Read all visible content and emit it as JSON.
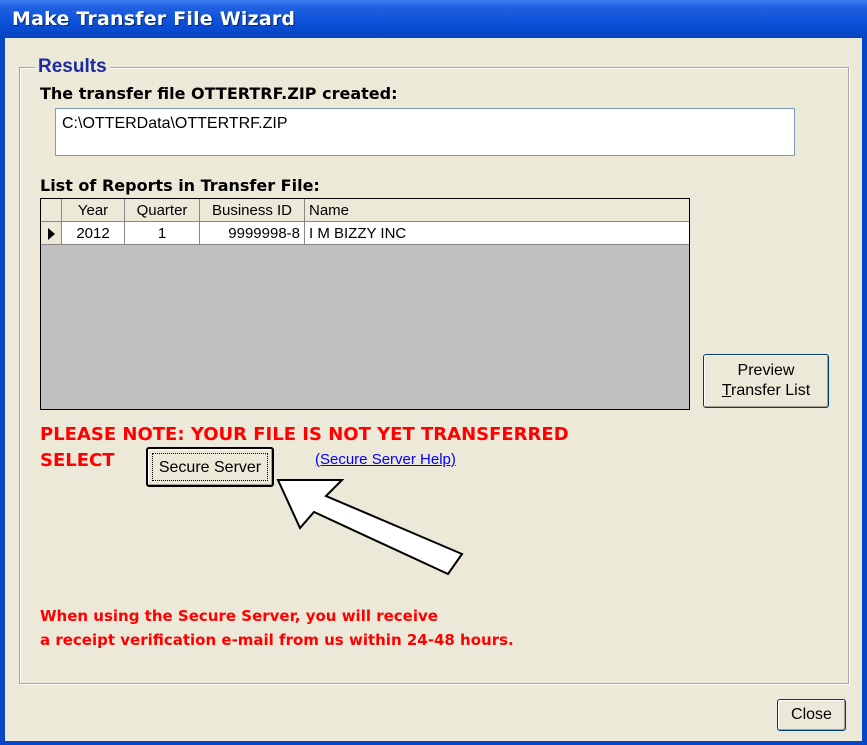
{
  "window": {
    "title": "Make Transfer File Wizard"
  },
  "results": {
    "legend": "Results",
    "created_label": "The transfer file OTTERTRF.ZIP created:",
    "file_path": "C:\\OTTERData\\OTTERTRF.ZIP",
    "list_label": "List of Reports in Transfer File:"
  },
  "grid": {
    "headers": [
      "Year",
      "Quarter",
      "Business ID",
      "Name"
    ],
    "rows": [
      {
        "year": "2012",
        "quarter": "1",
        "business_id": "9999998-8",
        "name": "I M BIZZY INC"
      }
    ]
  },
  "buttons": {
    "preview_line1": "Preview",
    "preview_line2_accel": "T",
    "preview_line2_rest": "ransfer List",
    "secure_server": "Secure Server",
    "close": "Close"
  },
  "note": {
    "warning": "PLEASE NOTE: YOUR FILE IS NOT YET TRANSFERRED",
    "select": "SELECT",
    "help_link": "(Secure Server Help)",
    "footer_line1": "When using the Secure Server, you will receive",
    "footer_line2": "a receipt verification e-mail from us within 24-48 hours."
  },
  "colors": {
    "titlebar": "#0a50d8",
    "warning_red": "#ff0000",
    "link_blue": "#0000ff",
    "legend_blue": "#1c2ca0"
  }
}
